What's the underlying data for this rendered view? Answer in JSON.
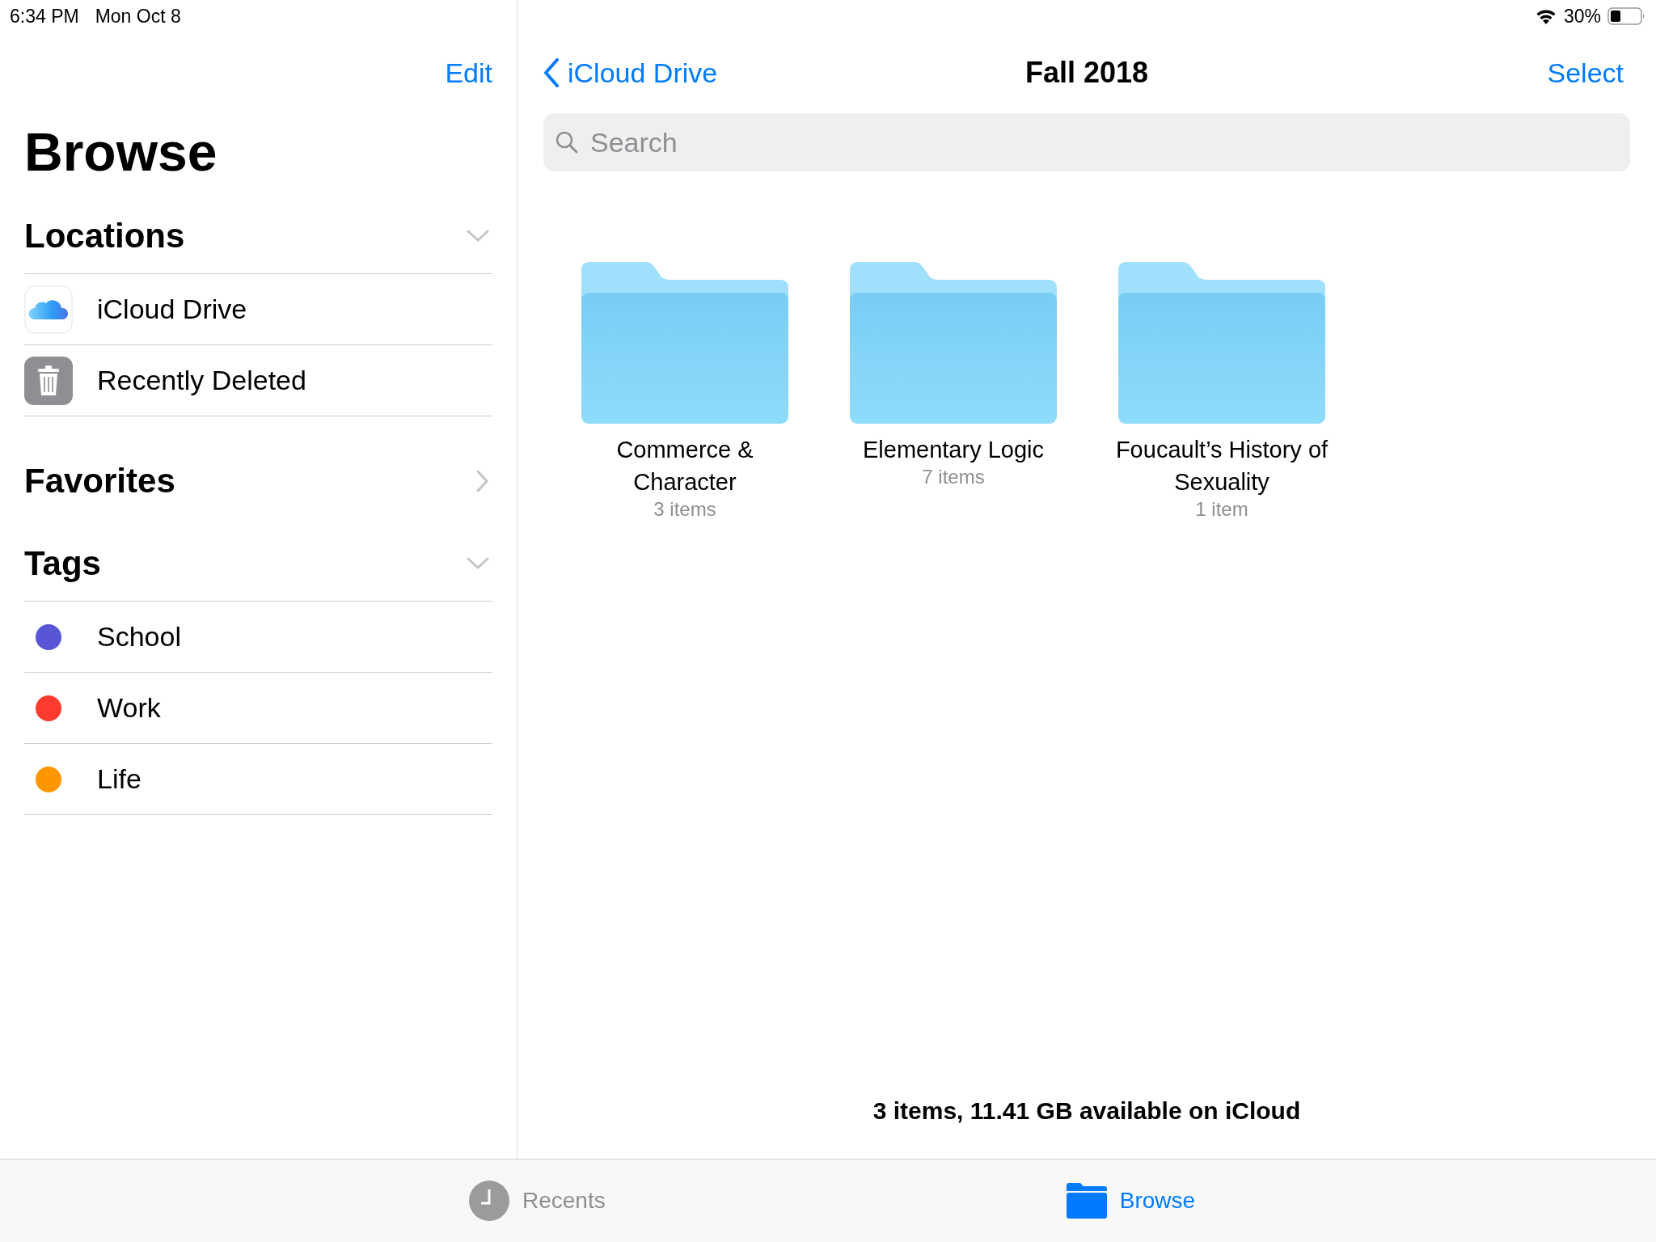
{
  "status_bar": {
    "time": "6:34 PM",
    "date": "Mon Oct 8",
    "battery_percent": "30%"
  },
  "sidebar": {
    "edit_button": "Edit",
    "title": "Browse",
    "sections": [
      {
        "title": "Locations",
        "expanded": true,
        "items": [
          {
            "label": "iCloud Drive",
            "kind": "icloud"
          },
          {
            "label": "Recently Deleted",
            "kind": "trash"
          }
        ]
      },
      {
        "title": "Favorites",
        "expanded": false
      },
      {
        "title": "Tags",
        "expanded": true,
        "items": [
          {
            "label": "School",
            "kind": "tag",
            "color": "#5856d6"
          },
          {
            "label": "Work",
            "kind": "tag",
            "color": "#ff3b30"
          },
          {
            "label": "Life",
            "kind": "tag",
            "color": "#ff9500"
          }
        ]
      }
    ]
  },
  "main": {
    "back_button": "iCloud Drive",
    "title": "Fall 2018",
    "select_button": "Select",
    "search": {
      "placeholder": "Search"
    },
    "folders": [
      {
        "name": "Commerce & Character",
        "count": "3 items"
      },
      {
        "name": "Elementary Logic",
        "count": "7 items"
      },
      {
        "name": "Foucault’s History of Sexuality",
        "count": "1 item"
      }
    ],
    "footer": "3 items, 11.41 GB available on iCloud"
  },
  "tab_bar": {
    "tabs": [
      {
        "label": "Recents",
        "kind": "recents",
        "selected": false
      },
      {
        "label": "Browse",
        "kind": "browse",
        "selected": true
      }
    ]
  }
}
